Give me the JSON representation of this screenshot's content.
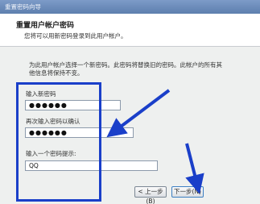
{
  "window": {
    "title": "重置密码向导"
  },
  "header": {
    "title": "重置用户帐户密码",
    "subtitle": "您将可以用新密码登录到此用户帐户。"
  },
  "instruction": "为此用户帐户选择一个新密码。此密码将替换旧的密码。此帐户的所有其他信息将保持不变。",
  "form": {
    "new_password_label": "输入新密码",
    "new_password_value": "●●●●●●",
    "confirm_password_label": "再次输入密码以确认",
    "confirm_password_value": "●●●●●●",
    "hint_label": "输入一个密码提示:",
    "hint_value": "QQ"
  },
  "buttons": {
    "back": "< 上一步(B)",
    "next": "下一步(N)"
  },
  "colors": {
    "annotation": "#1a3fc9",
    "titlebar": "#5d7fae"
  }
}
